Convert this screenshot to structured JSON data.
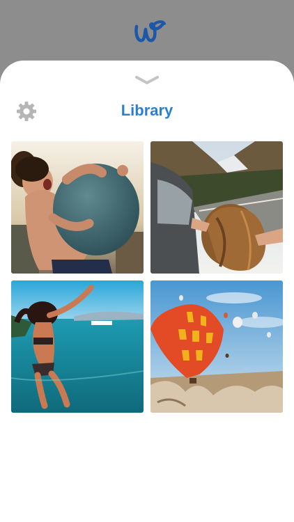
{
  "header": {
    "title": "Library",
    "logo_icon": "script-w-logo-icon",
    "settings_icon": "gear-icon",
    "collapse_icon": "chevron-down-icon"
  },
  "library": {
    "photos": [
      {
        "subject": "child-with-exercise-ball"
      },
      {
        "subject": "woman-leaning-out-car-window"
      },
      {
        "subject": "girl-jumping-into-sea"
      },
      {
        "subject": "hot-air-balloons"
      }
    ]
  },
  "colors": {
    "accent": "#2a7fd4",
    "logo": "#1d57a8",
    "sheet": "#ffffff",
    "backdrop": "#8d8d8d",
    "icon_gray": "#b5b5b5"
  }
}
